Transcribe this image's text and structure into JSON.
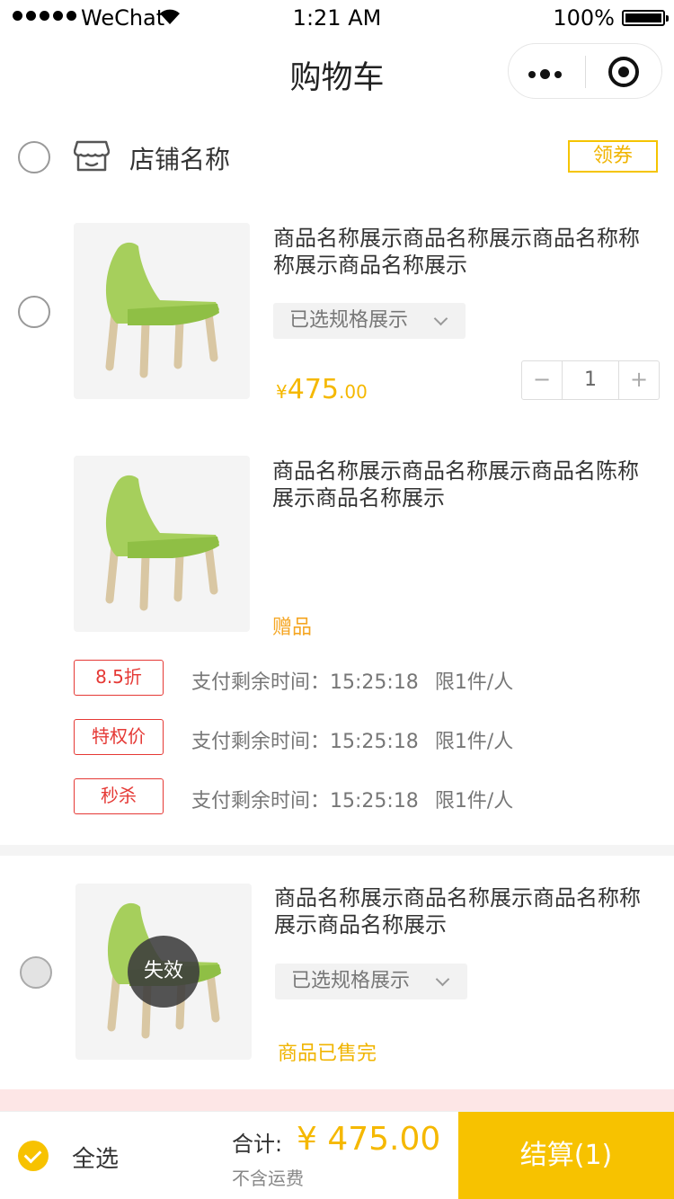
{
  "status_bar": {
    "carrier": "WeChat",
    "time": "1:21 AM",
    "battery": "100%"
  },
  "nav": {
    "title": "购物车"
  },
  "store": {
    "name": "店铺名称",
    "coupon_label": "领券"
  },
  "items": [
    {
      "title": "商品名称展示商品名称展示商品名称称称展示商品名称展示",
      "spec": "已选规格展示",
      "price_currency": "¥",
      "price_integer": "475",
      "price_decimal": ".00",
      "quantity": "1",
      "minus": "−",
      "plus": "+"
    },
    {
      "title": "商品名称展示商品名称展示商品名陈称展示商品名称展示",
      "gift_label": "赠品"
    },
    {
      "title": "商品名称展示商品名称展示商品名称称展示商品名称展示",
      "spec": "已选规格展示",
      "invalid_label": "失效",
      "status": "商品已售完"
    }
  ],
  "promos": [
    {
      "tag": "8.5折",
      "text": "支付剩余时间：15:25:18",
      "limit": "限1件/人"
    },
    {
      "tag": "特权价",
      "text": "支付剩余时间：15:25:18",
      "limit": "限1件/人"
    },
    {
      "tag": "秒杀",
      "text": "支付剩余时间：15:25:18",
      "limit": "限1件/人"
    }
  ],
  "bottom_bar": {
    "select_all": "全选",
    "total_label": "合计:",
    "total_amount": "¥ 475.00",
    "shipping_note": "不含运费",
    "checkout_label": "结算(1)"
  },
  "colors": {
    "accent": "#f7c200",
    "price": "#f5b800",
    "promo_red": "#e53935"
  },
  "icons": [
    "wifi-icon",
    "battery-icon",
    "more-dots-icon",
    "close-target-icon",
    "store-icon",
    "chevron-down-icon",
    "check-icon"
  ]
}
